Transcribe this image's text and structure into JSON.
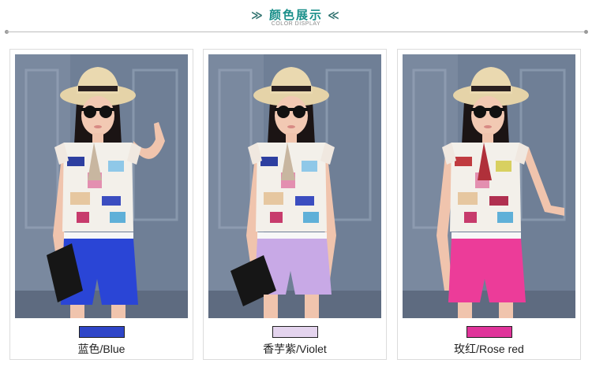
{
  "header": {
    "title": "颜色展示",
    "subtitle": "COLOR DISPLAY",
    "left_chevron_glyph": "≫",
    "right_chevron_glyph": "≪"
  },
  "colors": {
    "accent": "#1a8f8a",
    "rule": "#bdbdbd"
  },
  "products": [
    {
      "label": "蓝色/Blue",
      "swatch_color": "#2e45c8",
      "shorts_color": "#2a45d6"
    },
    {
      "label": "香芋紫/Violet",
      "swatch_color": "#e4d4ee",
      "shorts_color": "#c8a9e6"
    },
    {
      "label": "玫红/Rose red",
      "swatch_color": "#e0339a",
      "shorts_color": "#ec3c99"
    }
  ]
}
